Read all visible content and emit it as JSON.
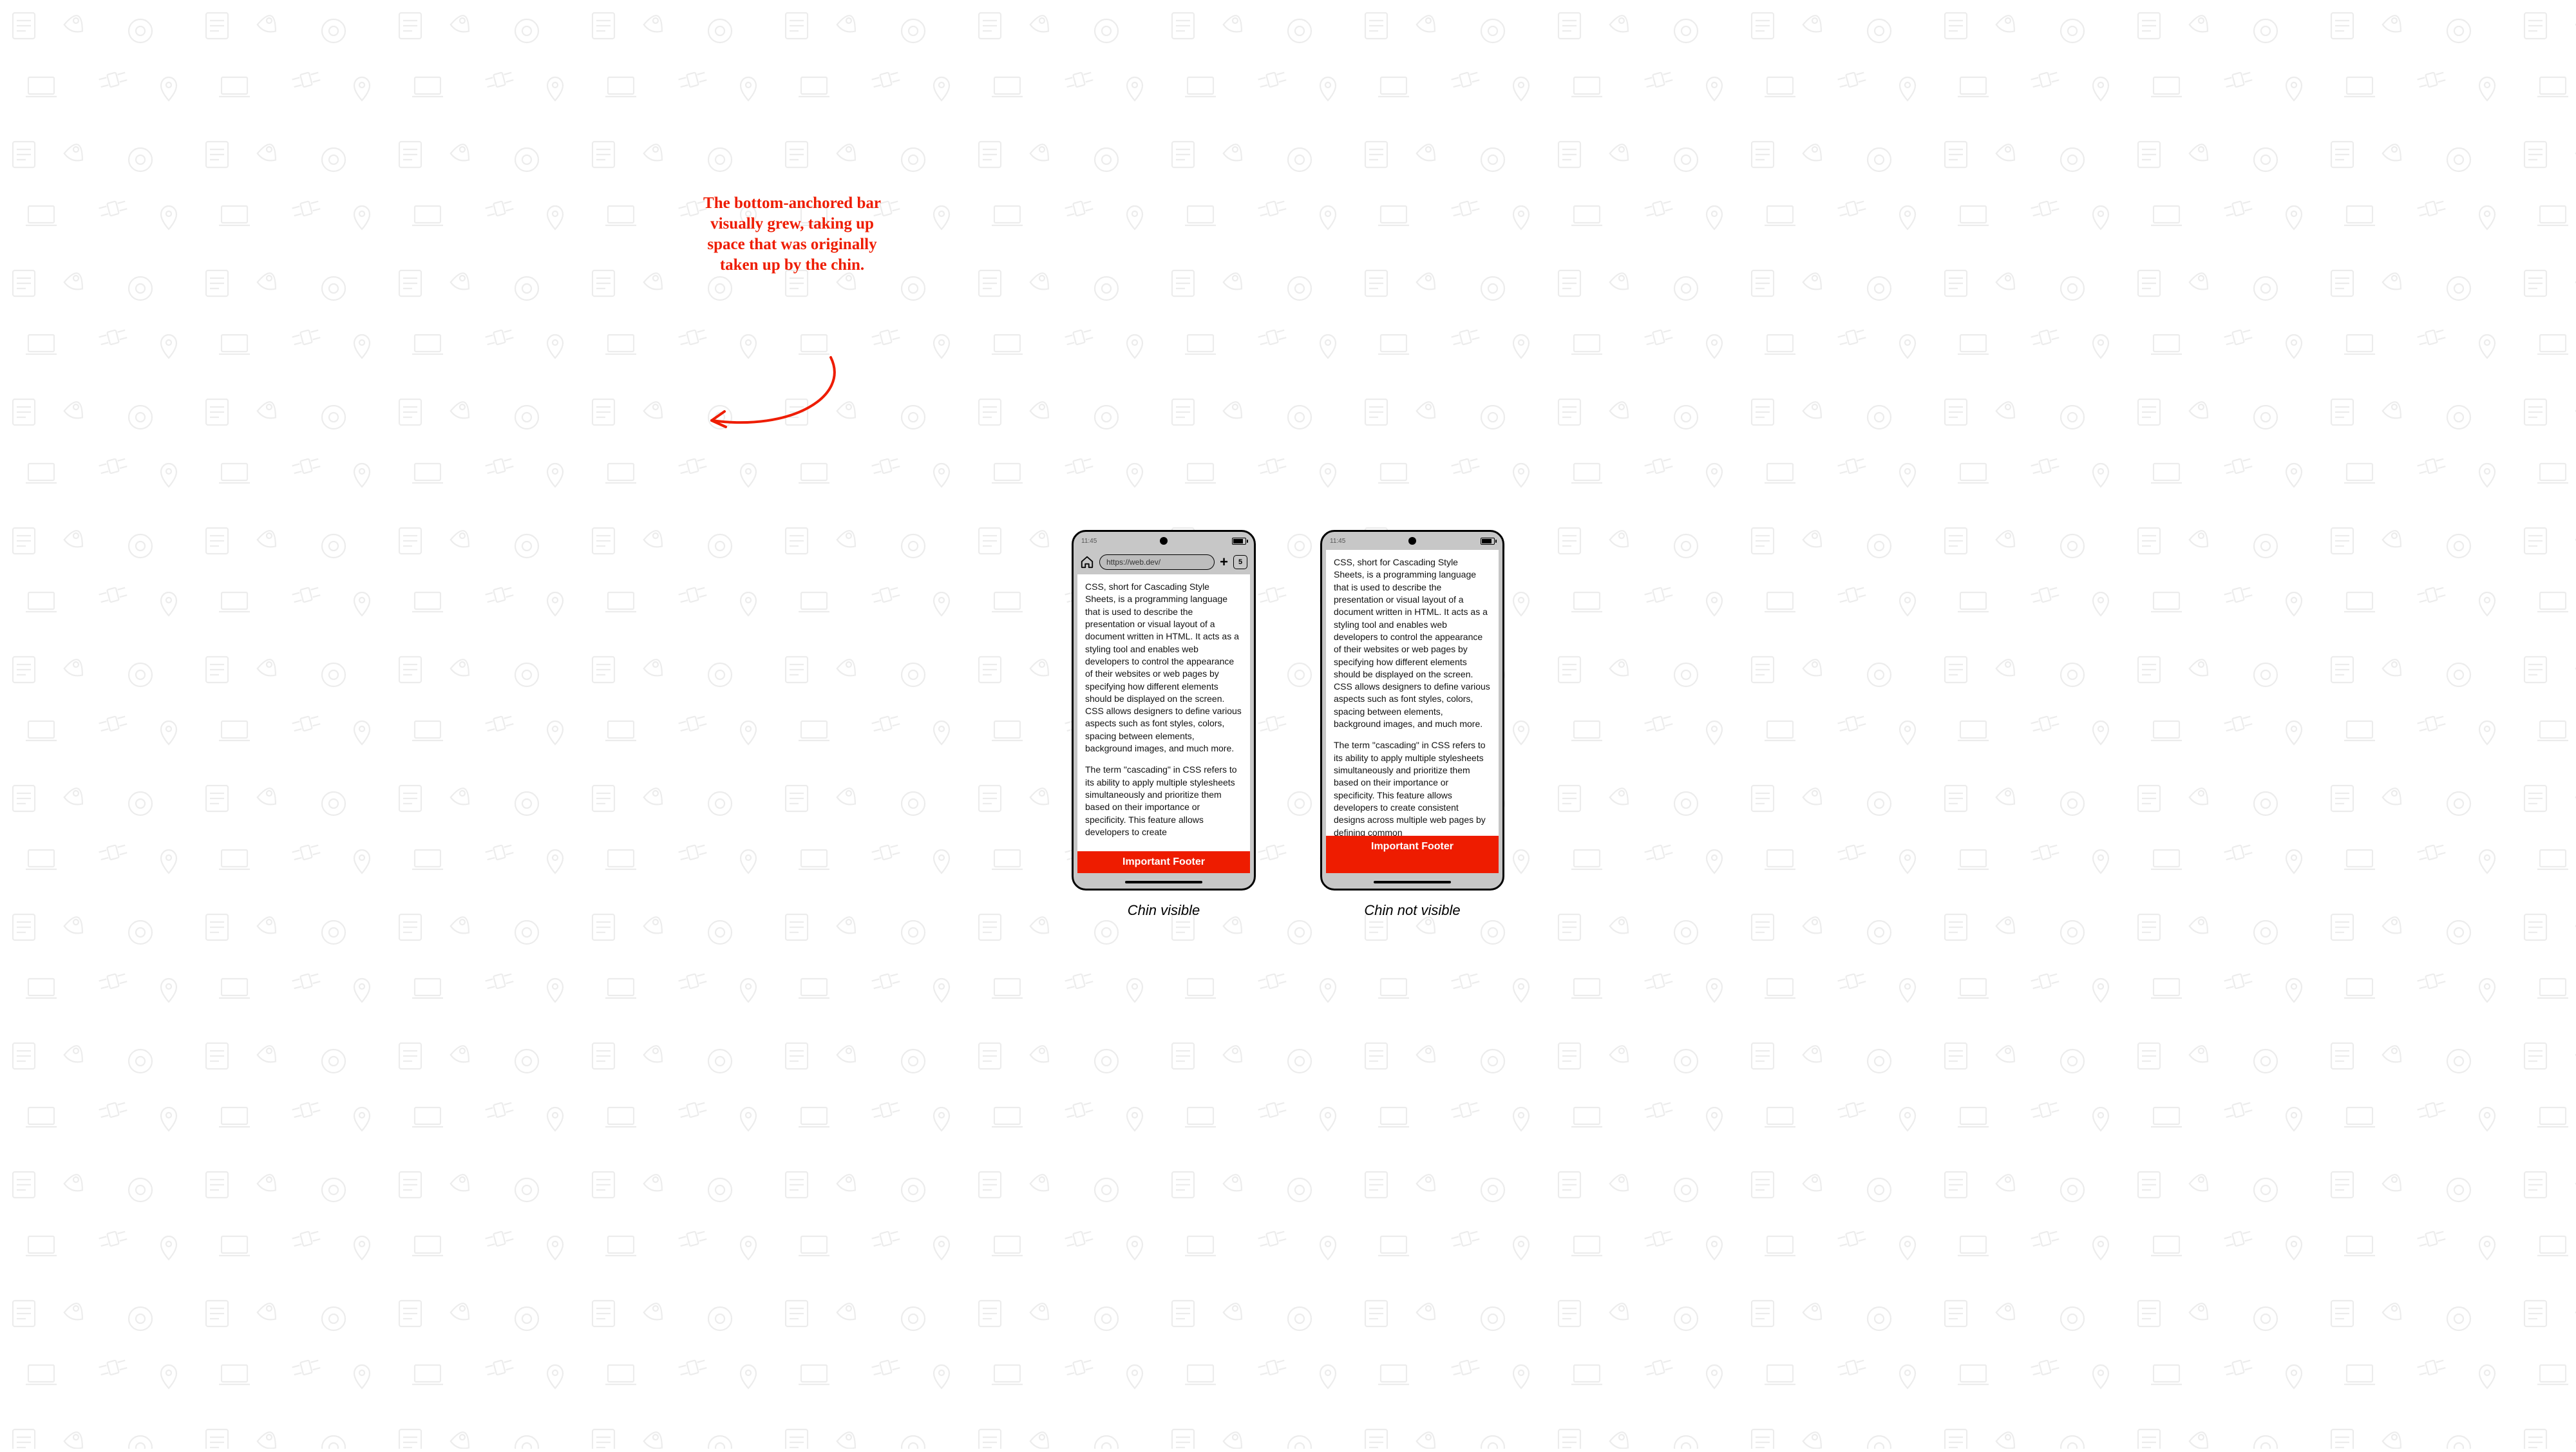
{
  "status": {
    "time": "11:45"
  },
  "browser": {
    "url": "https://web.dev/",
    "tab_count": "5"
  },
  "content": {
    "p1": "CSS, short for Cascading Style Sheets, is a programming language that is used to describe the presentation or visual layout of a document written in HTML. It acts as a styling tool and enables web developers to control the appearance of their websites or web pages by specifying how different elements should be displayed on the screen. CSS allows designers to define various aspects such as font styles, colors, spacing between elements, background images, and much more.",
    "p2_short": "The term \"cascading\" in CSS refers to its ability to apply multiple stylesheets simultaneously and prioritize them based on their importance or specificity. This feature allows developers to create",
    "p2_long": "The term \"cascading\" in CSS refers to its ability to apply multiple stylesheets simultaneously and prioritize them based on their importance or specificity. This feature allows developers to create consistent designs across multiple web pages by defining common"
  },
  "footer": {
    "label": "Important Footer",
    "bg": "#ee1c00"
  },
  "captions": {
    "left": "Chin visible",
    "right": "Chin not visible"
  },
  "annotation": {
    "text": "The bottom-anchored bar visually grew, taking up space that was originally taken up by the chin.",
    "color": "#ee1c00"
  }
}
